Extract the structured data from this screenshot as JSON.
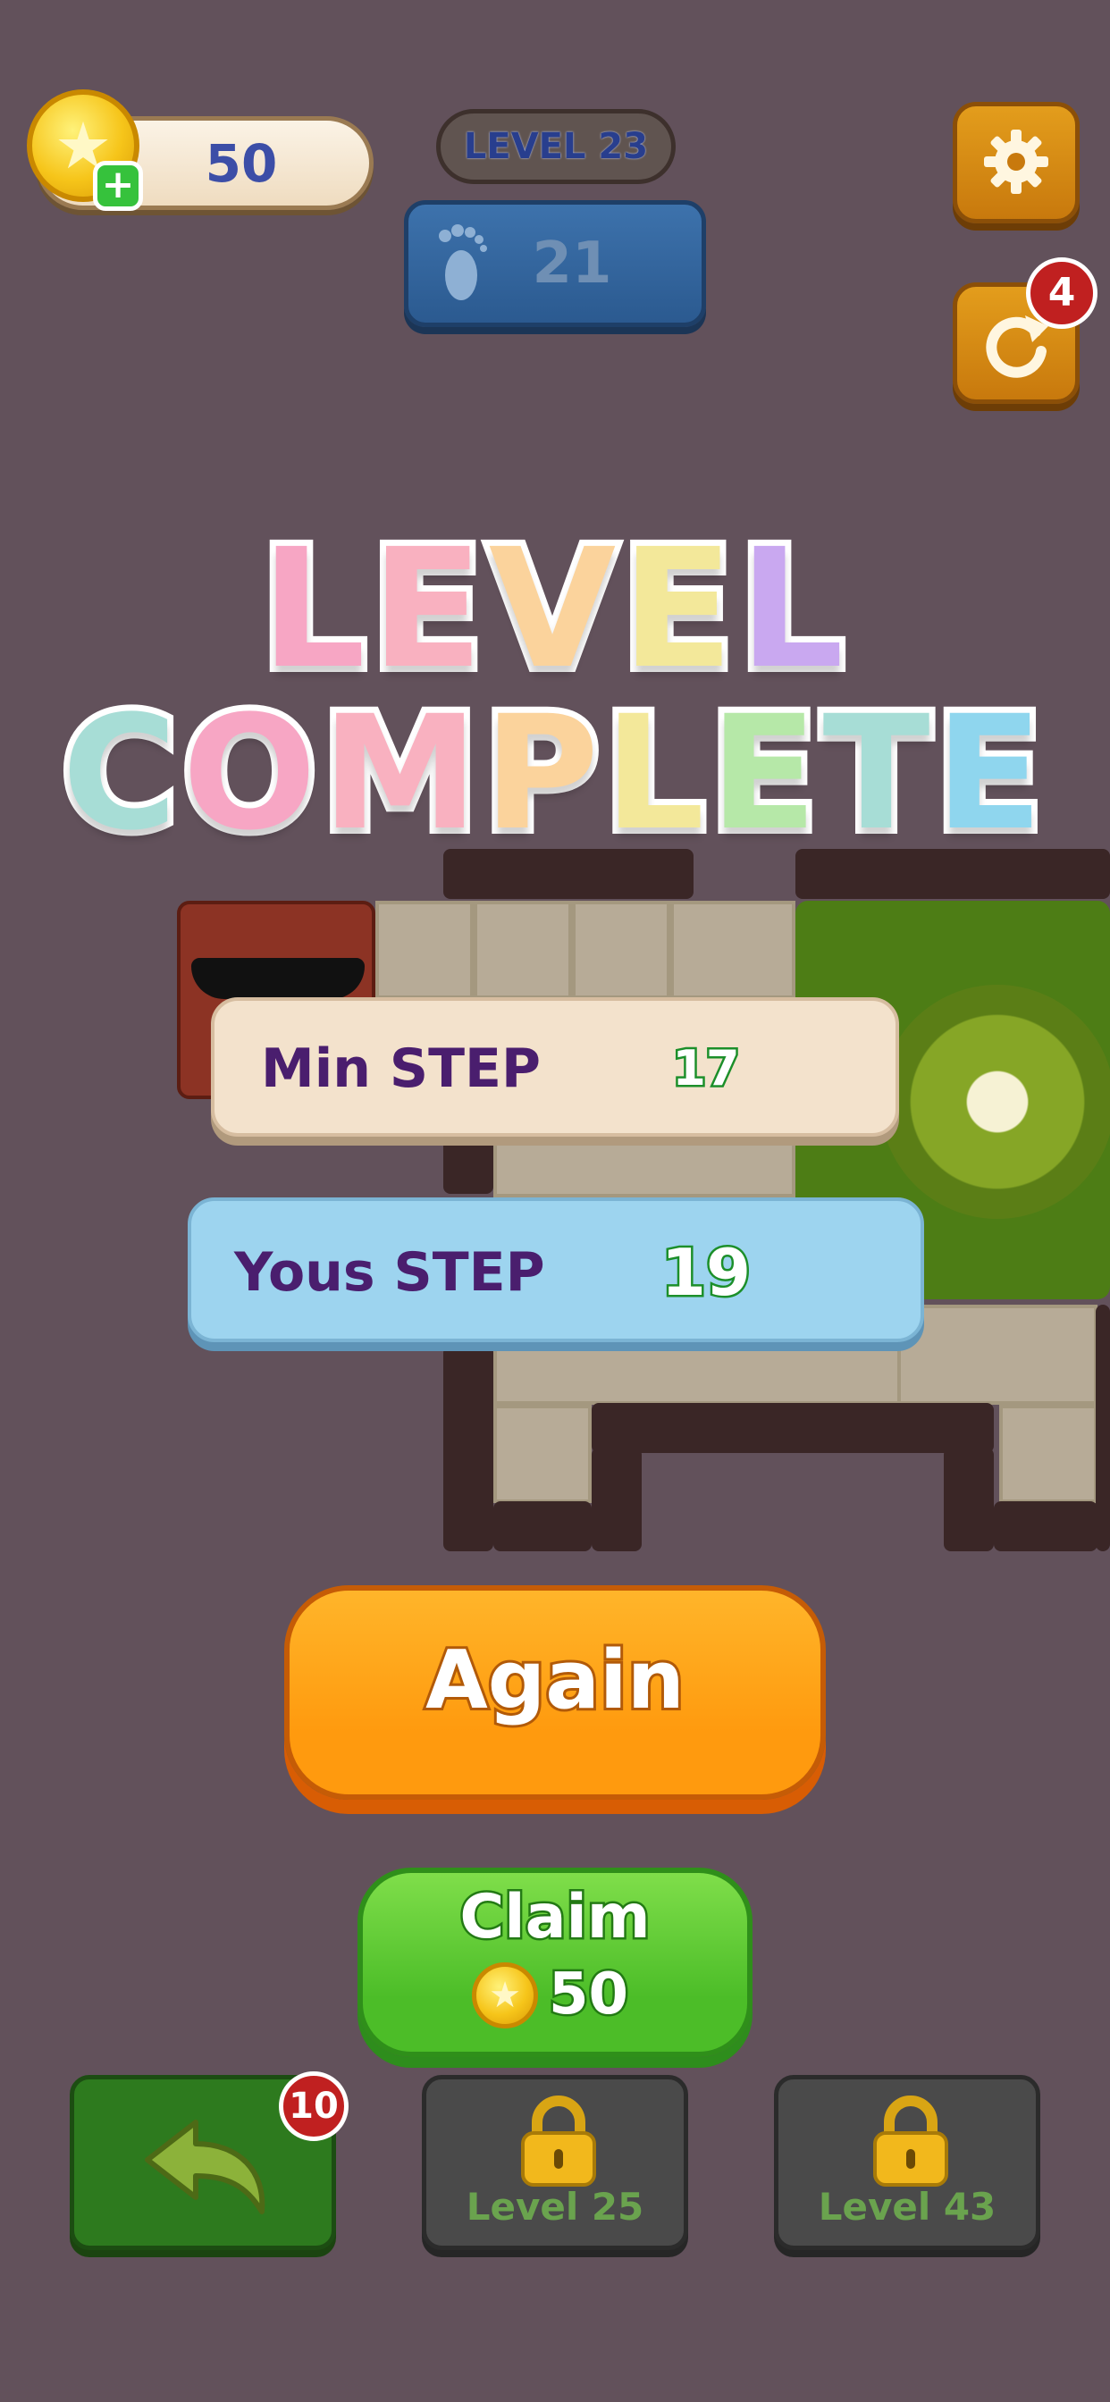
{
  "header": {
    "coins": "50",
    "level_label": "LEVEL 23",
    "steps_count": "21",
    "restart_badge": "4"
  },
  "title": {
    "line1": "LEVEL",
    "line2": "COMPLETE"
  },
  "results": {
    "min_step_label": "Min STEP",
    "min_step_value": "17",
    "your_step_label": "Yous STEP",
    "your_step_value": "19"
  },
  "actions": {
    "again_label": "Again",
    "claim_label": "Claim",
    "claim_amount": "50"
  },
  "bottom": {
    "undo_badge": "10",
    "locked_level_1": "Level 25",
    "locked_level_2": "Level 43"
  },
  "colors": {
    "background": "#62515b",
    "again_orange": "#ff9a0e",
    "claim_green": "#4cbd28",
    "title_letters": [
      "#f7a6c4",
      "#f9b1c0",
      "#fbd39c",
      "#f3e89a",
      "#c9a8f0",
      "#a7ddd6",
      "#f7a6c4",
      "#f9b1c0",
      "#fbd39c",
      "#f3e89a",
      "#b6e8a8",
      "#a7ddd6",
      "#8fd6ee"
    ]
  },
  "icons": [
    "star-coin-icon",
    "plus-icon",
    "footprint-icon",
    "gear-icon",
    "restart-icon",
    "undo-arrow-icon",
    "lock-icon"
  ]
}
